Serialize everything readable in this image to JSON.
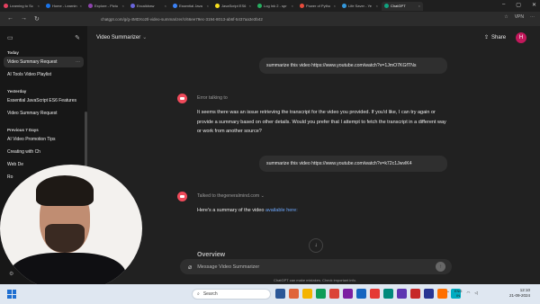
{
  "browser": {
    "tabs": [
      {
        "label": "Learning to Sc",
        "color": "#e4405f"
      },
      {
        "label": "Home - Learnin",
        "color": "#1a73e8"
      },
      {
        "label": "Explore - Pictu",
        "color": "#8e44ad"
      },
      {
        "label": "Excalidraw",
        "color": "#6965db"
      },
      {
        "label": "Essential Java",
        "color": "#3b82f6"
      },
      {
        "label": "JavaScript ES6",
        "color": "#f7df1e"
      },
      {
        "label": "Log Ink 2 - spr",
        "color": "#27ae60"
      },
      {
        "label": "Power of Pytho",
        "color": "#e74c3c"
      },
      {
        "label": "Life Saver - Ye",
        "color": "#3498db"
      },
      {
        "label": "ChatGPT",
        "color": "#10a37f"
      }
    ],
    "url": "chatgpt.com/g/g-4MDXo2tl-video-summarizer/c/66ee79ec-3194-8013-ab6f-5437aa3e3b42",
    "vpn_label": "VPN"
  },
  "sidebar": {
    "sections": [
      {
        "title": "Today",
        "items": [
          "Video Summary Request",
          "AI Tools Video Playlist"
        ]
      },
      {
        "title": "Yesterday",
        "items": [
          "Essential JavaScript ES6 Features",
          "Video Summary Request"
        ]
      },
      {
        "title": "Previous 7 Days",
        "items": [
          "AI Video Promotion Tips",
          "Creating with Ch",
          "Web De",
          "Ro"
        ]
      }
    ]
  },
  "header": {
    "title": "Video Summarizer",
    "share_label": "Share",
    "avatar_initial": "H"
  },
  "messages": [
    {
      "role": "user",
      "text": "summarize this video https://www.youtube.com/watch?v=1JmO7KGfTNs"
    },
    {
      "role": "assistant",
      "meta": "Error talking to",
      "text": "It seems there was an issue retrieving the transcript for the video you provided. If you'd like, I can try again or provide a summary based on other details. Would you prefer that I attempt to fetch the transcript in a different way or work from another source?"
    },
    {
      "role": "user",
      "text": "summarize this video https://www.youtube.com/watch?v=k72c1JwvlK4"
    },
    {
      "role": "assistant",
      "meta": "Talked to thegeneralmind.com",
      "text_prefix": "Here's a summary of the video ",
      "link": "available here:",
      "heading": "Overview"
    }
  ],
  "composer": {
    "placeholder": "Message Video Summarizer",
    "disclaimer": "ChatGPT can make mistakes. Check important info."
  },
  "taskbar": {
    "weather": "",
    "search_placeholder": "Search",
    "lang": "ENG",
    "region": "IN",
    "time": "12:10",
    "date": "21-09-2024"
  }
}
